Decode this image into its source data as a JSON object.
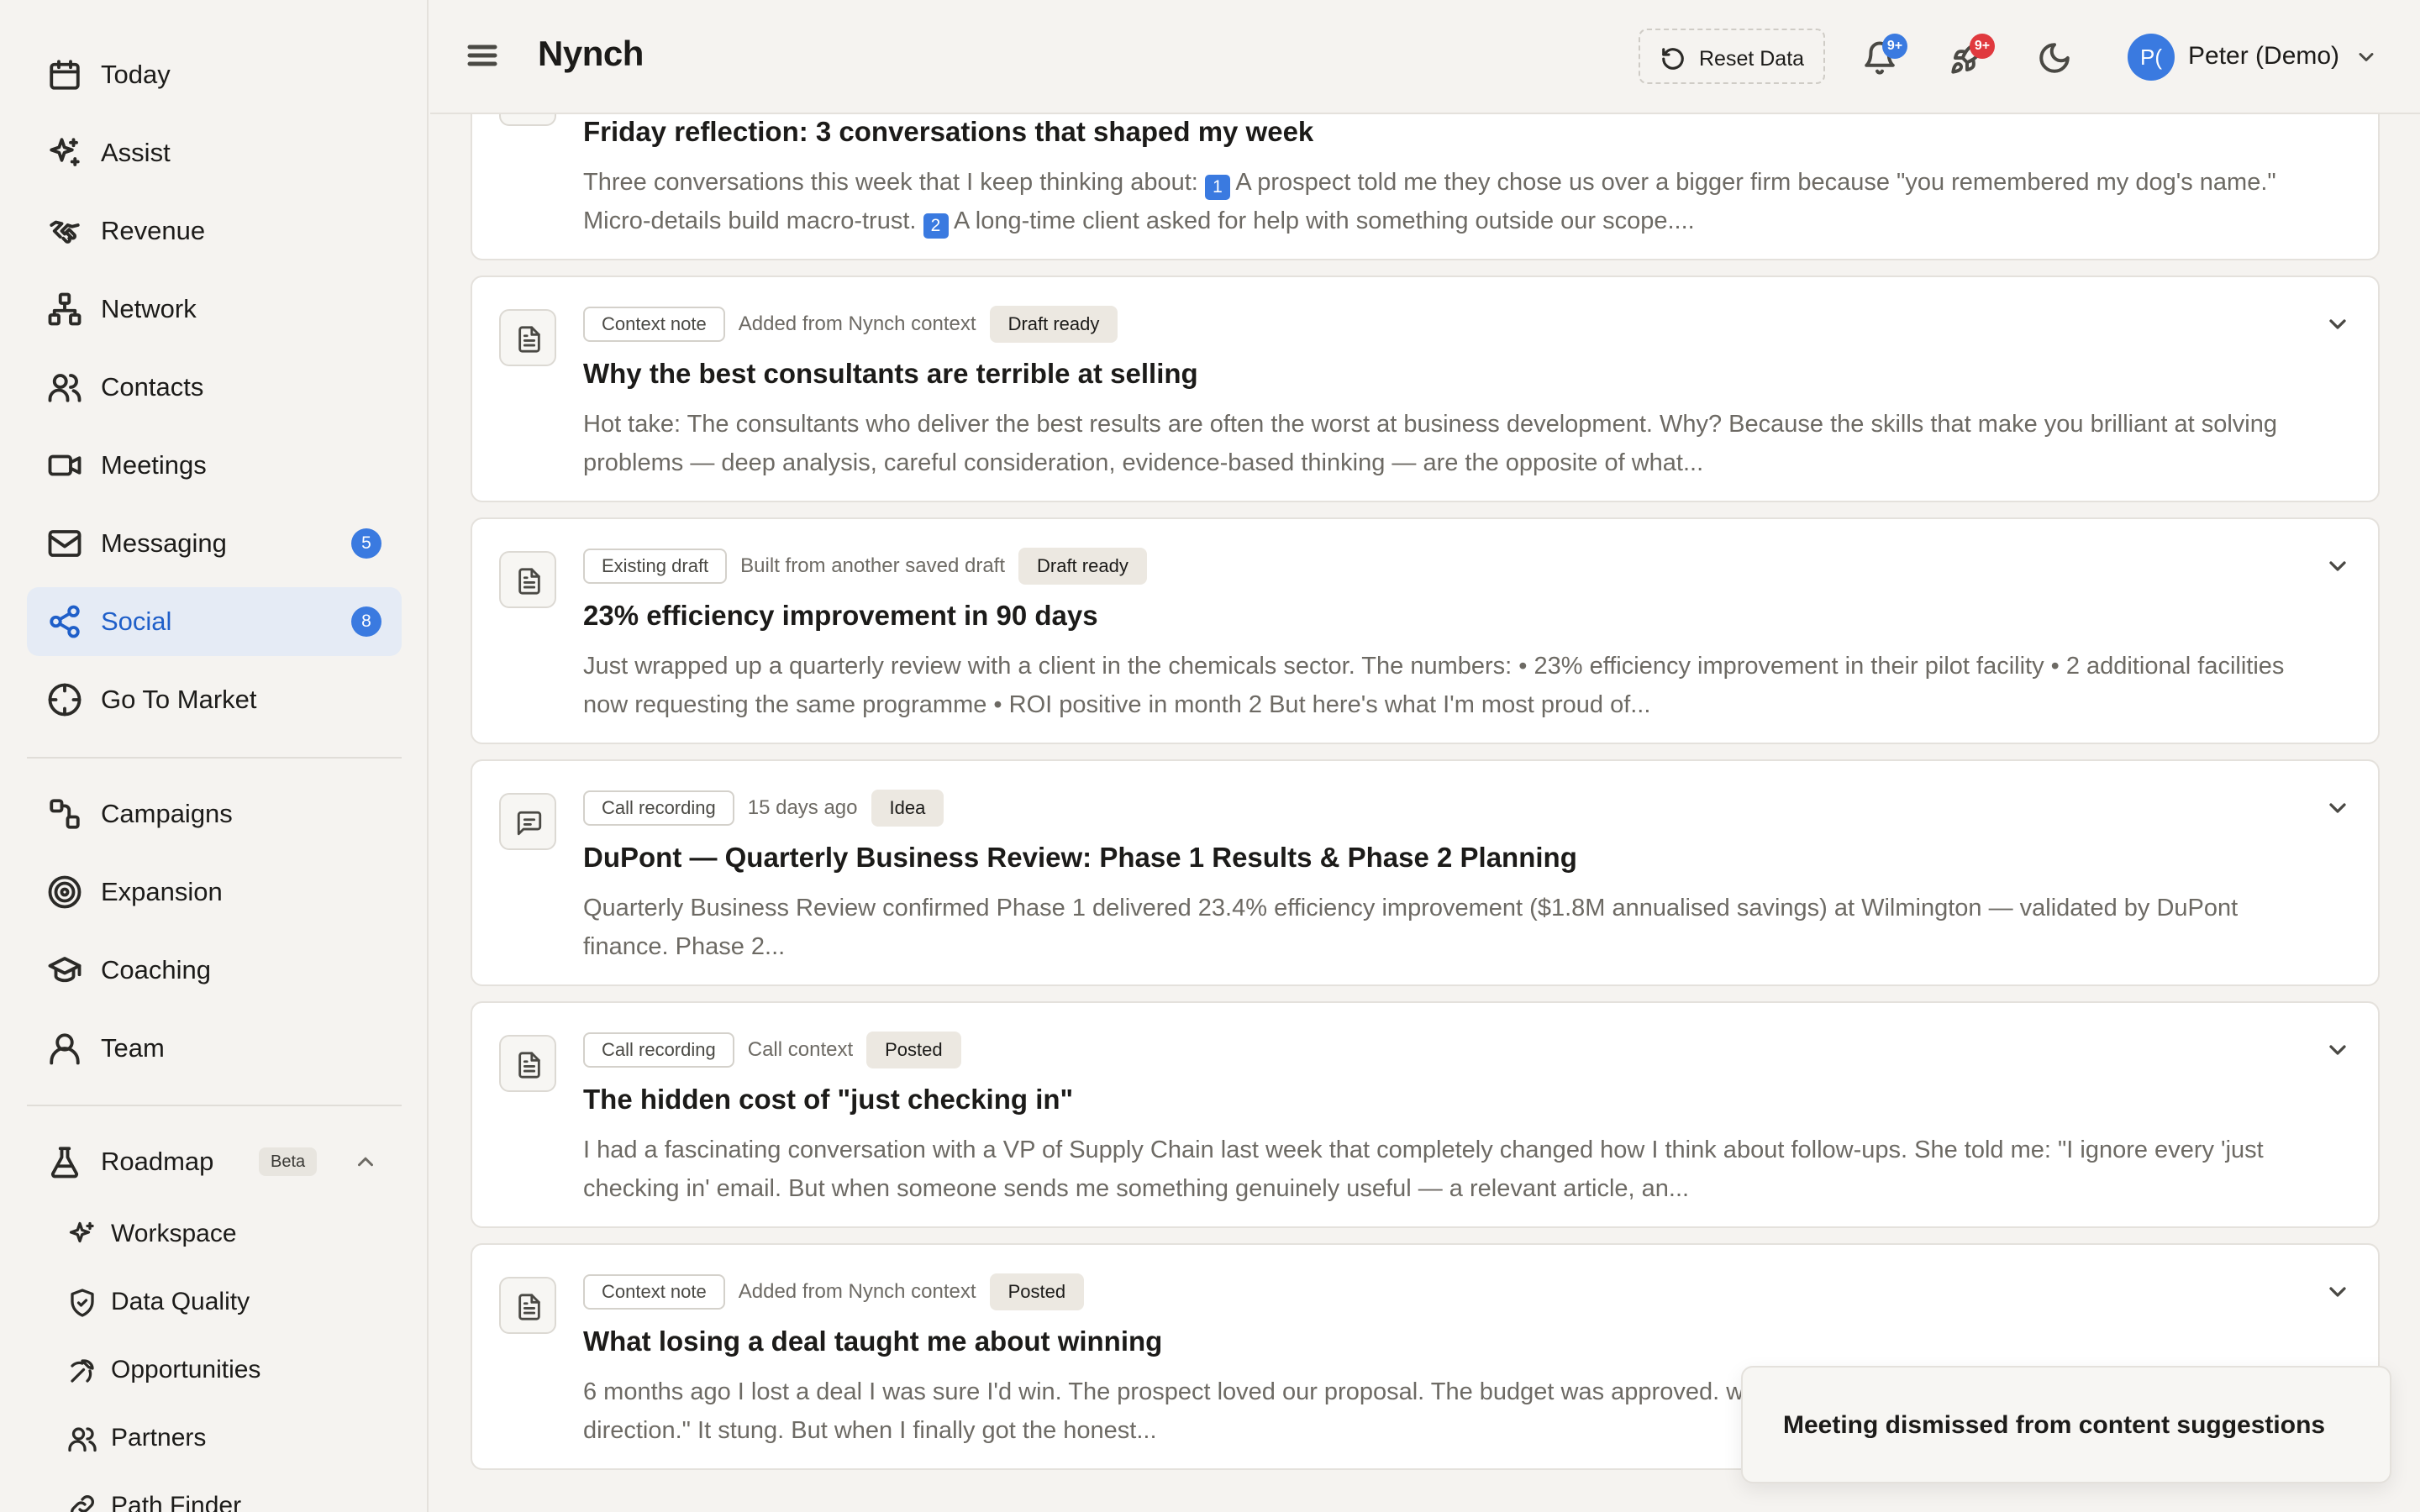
{
  "app": {
    "title": "Nynch"
  },
  "sidebar": {
    "primary": [
      {
        "label": "Today",
        "icon": "calendar-icon"
      },
      {
        "label": "Assist",
        "icon": "sparkles-icon"
      },
      {
        "label": "Revenue",
        "icon": "handshake-icon"
      },
      {
        "label": "Network",
        "icon": "network-icon"
      },
      {
        "label": "Contacts",
        "icon": "users-icon"
      },
      {
        "label": "Meetings",
        "icon": "video-icon"
      },
      {
        "label": "Messaging",
        "icon": "mail-icon",
        "badge": "5"
      },
      {
        "label": "Social",
        "icon": "share-icon",
        "badge": "8",
        "active": true
      },
      {
        "label": "Go To Market",
        "icon": "crosshair-icon"
      }
    ],
    "secondary": [
      {
        "label": "Campaigns",
        "icon": "route-icon"
      },
      {
        "label": "Expansion",
        "icon": "target-icon"
      },
      {
        "label": "Coaching",
        "icon": "graduation-cap-icon"
      },
      {
        "label": "Team",
        "icon": "user-icon"
      }
    ],
    "roadmap": {
      "label": "Roadmap",
      "badge": "Beta",
      "expanded": true,
      "items": [
        {
          "label": "Workspace",
          "icon": "sparkles-icon"
        },
        {
          "label": "Data Quality",
          "icon": "shield-check-icon"
        },
        {
          "label": "Opportunities",
          "icon": "pickaxe-icon"
        },
        {
          "label": "Partners",
          "icon": "users-icon"
        },
        {
          "label": "Path Finder",
          "icon": "link-icon"
        }
      ]
    }
  },
  "header": {
    "reset_label": "Reset Data",
    "notifications_badge": "9+",
    "activity_badge": "9+",
    "user": {
      "initials": "P(",
      "name": "Peter (Demo)"
    },
    "colors": {
      "notif_badge": "#3a7ae0",
      "activity_badge": "#e0393e"
    }
  },
  "feed": {
    "items": [
      {
        "source": "",
        "context": "",
        "status": "",
        "title": "Friday reflection: 3 conversations that shaped my week",
        "excerpt_before": "Three conversations this week that I keep thinking about: ",
        "excerpt_k1": "1",
        "excerpt_mid": " A prospect told me they chose us over a bigger firm because \"you remembered my dog's name.\" Micro-details build macro-trust. ",
        "excerpt_k2": "2",
        "excerpt_after": " A long-time client asked for help with something outside our scope...."
      },
      {
        "source": "Context note",
        "context": "Added from Nynch context",
        "status": "Draft ready",
        "icon": "document-icon",
        "title": "Why the best consultants are terrible at selling",
        "excerpt": "Hot take: The consultants who deliver the best results are often the worst at business development. Why? Because the skills that make you brilliant at solving problems — deep analysis, careful consideration, evidence-based thinking — are the opposite of what..."
      },
      {
        "source": "Existing draft",
        "context": "Built from another saved draft",
        "status": "Draft ready",
        "icon": "document-icon",
        "title": "23% efficiency improvement in 90 days",
        "excerpt": "Just wrapped up a quarterly review with a client in the chemicals sector. The numbers: • 23% efficiency improvement in their pilot facility • 2 additional facilities now requesting the same programme • ROI positive in month 2 But here's what I'm most proud of..."
      },
      {
        "source": "Call recording",
        "context": "15 days ago",
        "status": "Idea",
        "icon": "message-icon",
        "title": "DuPont — Quarterly Business Review: Phase 1 Results & Phase 2 Planning",
        "excerpt": "Quarterly Business Review confirmed Phase 1 delivered 23.4% efficiency improvement ($1.8M annualised savings) at Wilmington — validated by DuPont finance. Phase 2..."
      },
      {
        "source": "Call recording",
        "context": "Call context",
        "status": "Posted",
        "icon": "document-icon",
        "title": "The hidden cost of \"just checking in\"",
        "excerpt": "I had a fascinating conversation with a VP of Supply Chain last week that completely changed how I think about follow-ups. She told me: \"I ignore every 'just checking in' email. But when someone sends me something genuinely useful — a relevant article, an..."
      },
      {
        "source": "Context note",
        "context": "Added from Nynch context",
        "status": "Posted",
        "icon": "document-icon",
        "title": "What losing a deal taught me about winning",
        "excerpt": "6 months ago I lost a deal I was sure I'd win. The prospect loved our proposal. The budget was approved. weeks later: \"We've decided to go in a different direction.\" It stung. But when I finally got the honest..."
      }
    ]
  },
  "toast": {
    "message": "Meeting dismissed from content suggestions"
  }
}
